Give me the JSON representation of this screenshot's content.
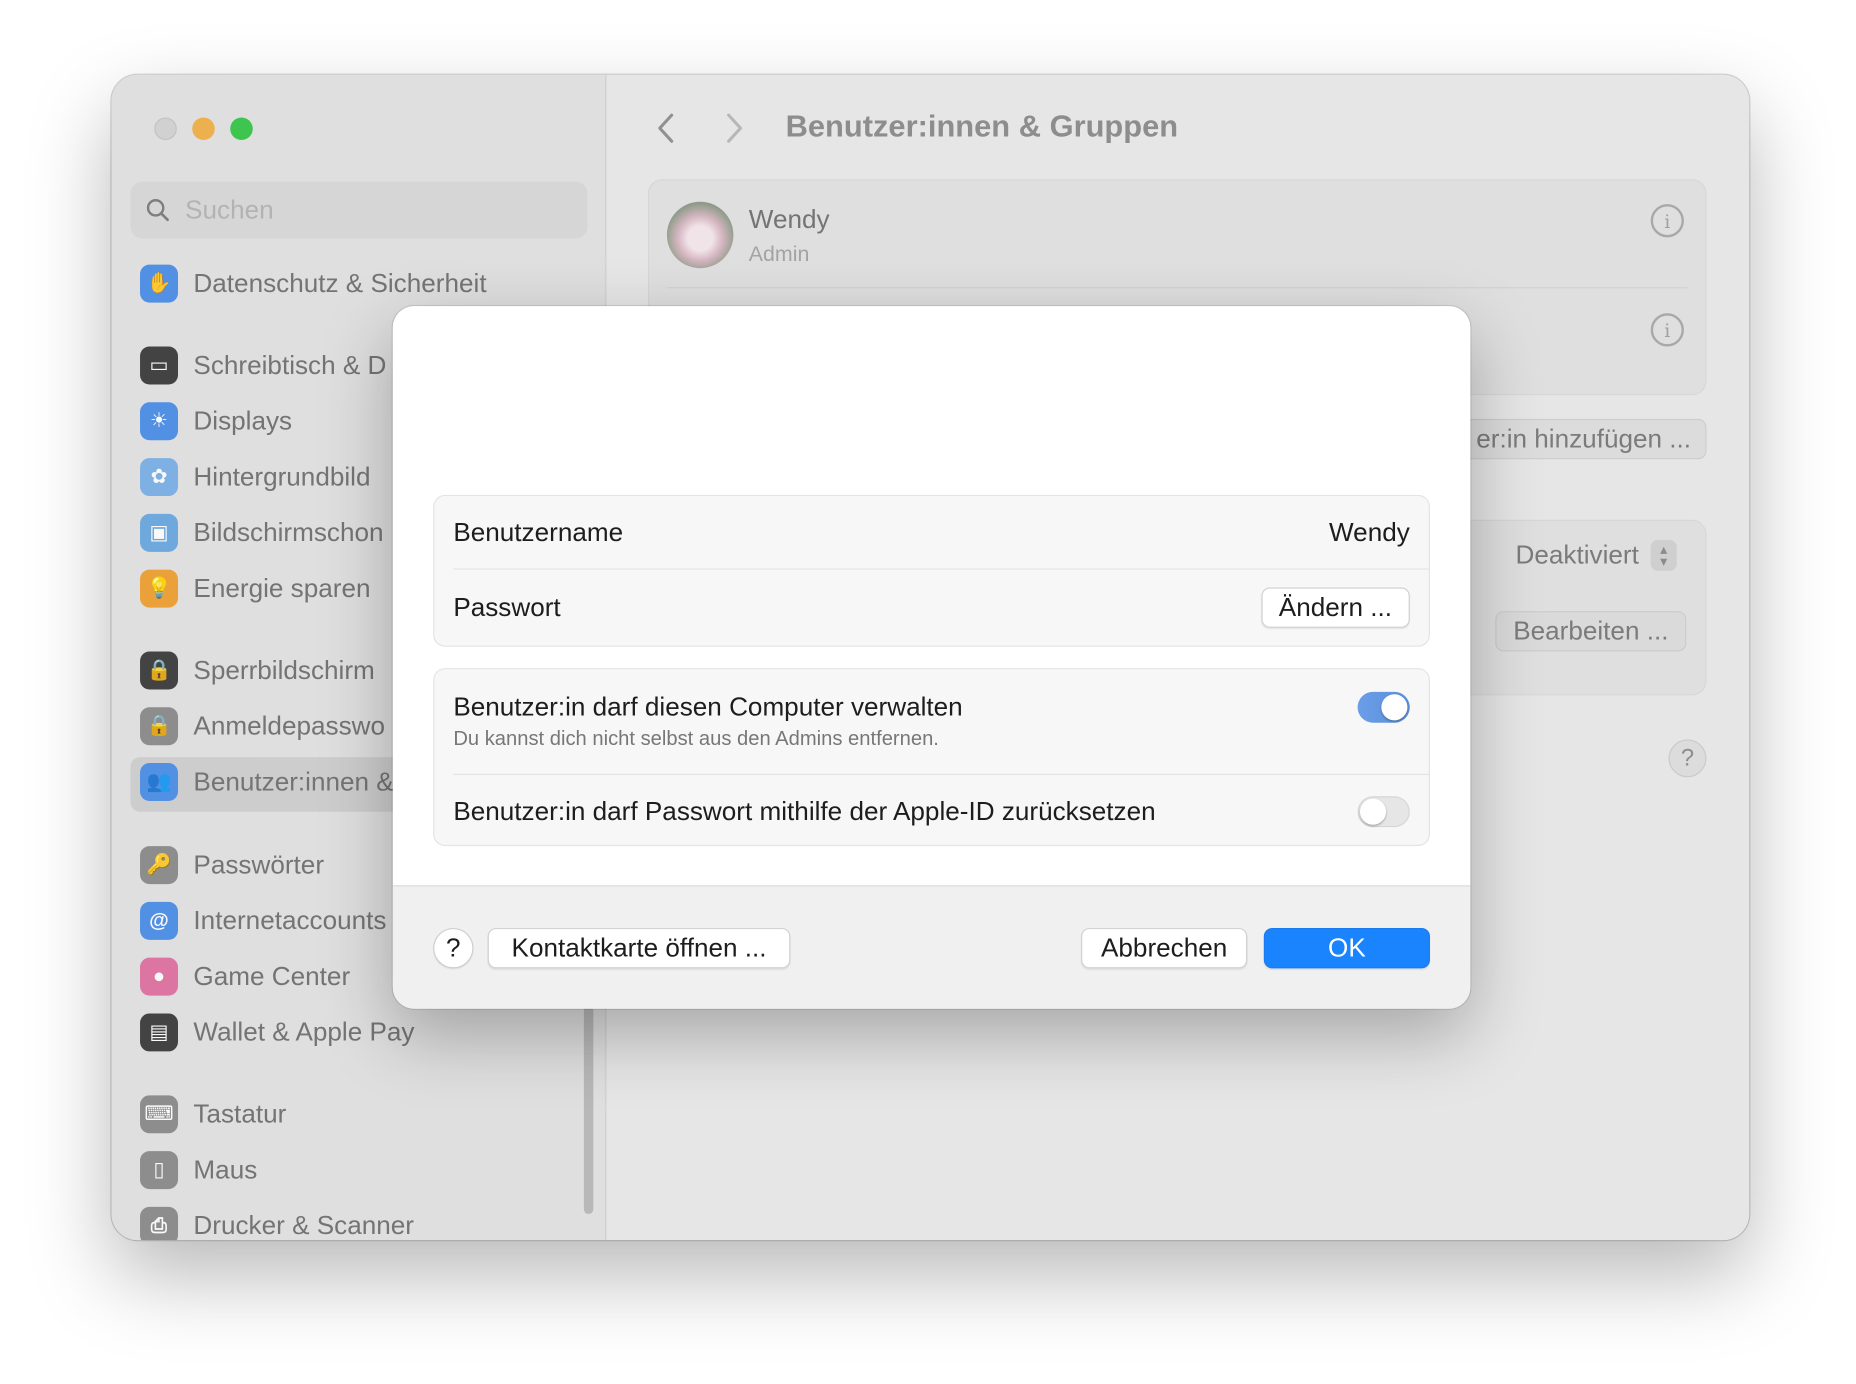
{
  "window": {
    "title": "Benutzer:innen & Gruppen"
  },
  "sidebar": {
    "search_placeholder": "Suchen",
    "items": [
      {
        "label": "Datenschutz & Sicherheit",
        "icon": "hand-icon",
        "color": "#4a8ee8"
      },
      {
        "label": "Schreibtisch & D",
        "icon": "desktop-icon",
        "color": "#3a3a3a"
      },
      {
        "label": "Displays",
        "icon": "sun-icon",
        "color": "#4a8ee8"
      },
      {
        "label": "Hintergrundbild",
        "icon": "flower-icon",
        "color": "#7ab0e8"
      },
      {
        "label": "Bildschirmschon",
        "icon": "screensaver-icon",
        "color": "#6aa8e0"
      },
      {
        "label": "Energie sparen",
        "icon": "bulb-icon",
        "color": "#f0a030"
      },
      {
        "label": "Sperrbildschirm",
        "icon": "lock-screen-icon",
        "color": "#3a3a3a"
      },
      {
        "label": "Anmeldepasswo",
        "icon": "lock-icon",
        "color": "#8a8a8a"
      },
      {
        "label": "Benutzer:innen &",
        "icon": "users-icon",
        "color": "#4a8ee8"
      },
      {
        "label": "Passwörter",
        "icon": "key-icon",
        "color": "#8a8a8a"
      },
      {
        "label": "Internetaccounts",
        "icon": "at-icon",
        "color": "#4a8ee8"
      },
      {
        "label": "Game Center",
        "icon": "game-center-icon",
        "color": "#e070a0"
      },
      {
        "label": "Wallet & Apple Pay",
        "icon": "wallet-icon",
        "color": "#3a3a3a"
      },
      {
        "label": "Tastatur",
        "icon": "keyboard-icon",
        "color": "#8a8a8a"
      },
      {
        "label": "Maus",
        "icon": "mouse-icon",
        "color": "#8a8a8a"
      },
      {
        "label": "Drucker & Scanner",
        "icon": "printer-icon",
        "color": "#8a8a8a"
      }
    ]
  },
  "main": {
    "user_name": "Wendy",
    "user_role": "Admin",
    "add_user_label": "er:in hinzufügen ...",
    "guest_status": "Deaktiviert",
    "edit_label": "Bearbeiten ...",
    "help_label": "?"
  },
  "sheet": {
    "username_label": "Benutzername",
    "username_value": "Wendy",
    "password_label": "Passwort",
    "change_password_label": "Ändern ...",
    "admin_toggle_label": "Benutzer:in darf diesen Computer verwalten",
    "admin_toggle_sub": "Du kannst dich nicht selbst aus den Admins entfernen.",
    "admin_toggle_on": true,
    "appleid_toggle_label": "Benutzer:in darf Passwort mithilfe der Apple-ID zurücksetzen",
    "appleid_toggle_on": false,
    "help_label": "?",
    "contact_card_label": "Kontaktkarte öffnen ...",
    "cancel_label": "Abbrechen",
    "ok_label": "OK",
    "accent_color": "#1a84ff"
  }
}
